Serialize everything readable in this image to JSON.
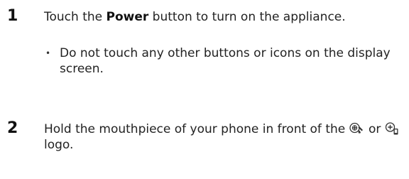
{
  "steps": [
    {
      "number": "1",
      "text_before": "Touch the ",
      "bold": "Power",
      "text_after": " button to turn on the appliance.",
      "bullet": "Do not touch any other buttons or icons on the display screen."
    },
    {
      "number": "2",
      "text_before": "Hold the mouthpiece of your phone in front of the ",
      "connector": " or ",
      "text_after": " logo."
    }
  ],
  "bullet_symbol": "•",
  "icons": [
    "smart-diagnosis-phone-logo-icon",
    "smart-diagnosis-handset-logo-icon"
  ]
}
